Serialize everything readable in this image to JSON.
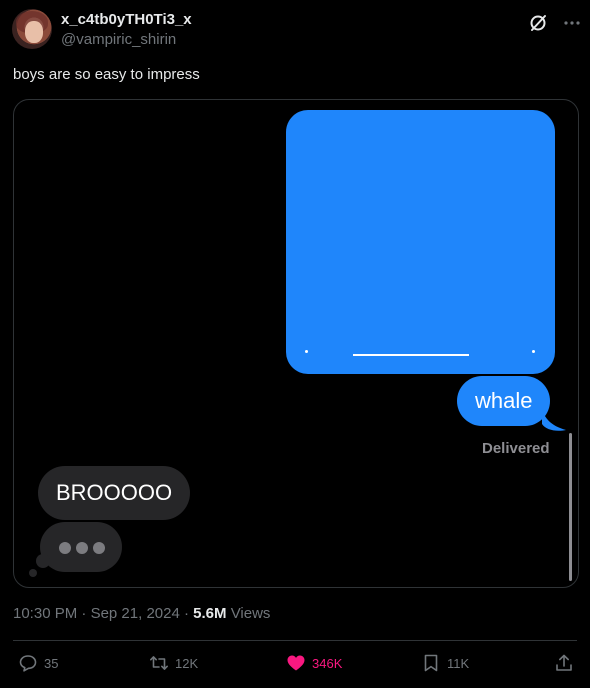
{
  "author": {
    "display_name": "x_c4tb0yTH0Ti3_x",
    "handle": "@vampiric_shirin"
  },
  "tweet": {
    "text": "boys are so easy to impress"
  },
  "imessage": {
    "sent_message": "whale",
    "status": "Delivered",
    "received_message": "BROOOOO",
    "sent_color": "#1f86fb",
    "received_color": "#262628"
  },
  "meta": {
    "time": "10:30 PM",
    "separator": "·",
    "date": "Sep 21, 2024",
    "views_count": "5.6M",
    "views_label": "Views"
  },
  "actions": {
    "replies": "35",
    "retweets": "12K",
    "likes": "346K",
    "bookmarks": "11K"
  },
  "icons": {
    "grok": "grok-icon",
    "more": "more-icon",
    "reply": "reply-icon",
    "retweet": "retweet-icon",
    "like": "heart-icon",
    "bookmark": "bookmark-icon",
    "share": "share-icon"
  },
  "colors": {
    "background": "#000000",
    "text": "#e7e9ea",
    "muted": "#71767b",
    "like_active": "#f91880",
    "border": "#2f3336"
  }
}
